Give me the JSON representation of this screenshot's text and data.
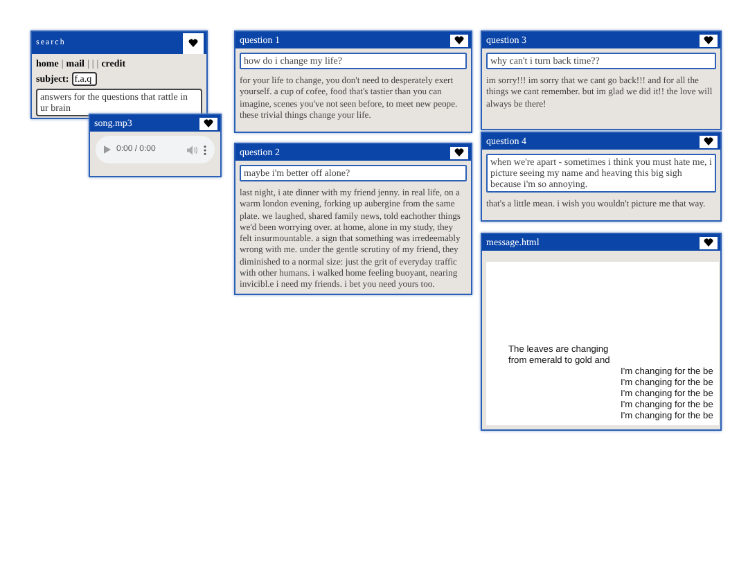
{
  "windows": [
    {
      "kind": "search",
      "title": "search",
      "nav": [
        {
          "kind": "link",
          "text": "home"
        },
        {
          "kind": "sep",
          "text": "|"
        },
        {
          "kind": "link",
          "text": "mail"
        },
        {
          "kind": "sep",
          "text": "|"
        },
        {
          "kind": "sep",
          "text": "|"
        },
        {
          "kind": "sep",
          "text": "|"
        },
        {
          "kind": "link",
          "text": "credit"
        }
      ],
      "subject_label": "subject:",
      "subject_value": "f.a.q",
      "description": "answers for the questions that rattle in ur brain"
    },
    {
      "kind": "audio",
      "title": "song.mp3",
      "time": "0:00 / 0:00"
    },
    {
      "kind": "question",
      "title": "question 1",
      "question": "how do i change my life?",
      "answer": "for your life to change, you don't need to desperately exert yourself. a cup of cofee, food that's tastier than you can imagine, scenes you've not seen before, to meet new peope. these trivial things change your life."
    },
    {
      "kind": "question",
      "title": "question 2",
      "question": "maybe i'm better off alone?",
      "answer": "last night, i ate dinner with my friend jenny. in real life, on a warm london evening, forking up aubergine from the same plate. we laughed, shared family news, told eachother things we'd been worrying over. at home, alone in my study, they felt insurmountable. a sign that something was irredeemably wrong with me. under the gentle scrutiny of my friend, they diminished to a normal size: just the grit of everyday traffic with other humans. i walked home feeling buoyant, nearing invicibl.e i need my friends. i bet you need yours too."
    },
    {
      "kind": "question",
      "title": "question 3",
      "question": "why can't i turn back time??",
      "answer": "im sorry!!! im sorry that we cant go back!!! and for all the things we cant remember. but im glad we did it!! the love will always be there!"
    },
    {
      "kind": "question",
      "title": "question 4",
      "question": "when we're apart - sometimes i think you must hate me, i picture seeing my name and heaving this big sigh because i'm so annoying.",
      "answer": "that's a little mean. i wish you wouldn't picture me that way."
    },
    {
      "kind": "message",
      "title": "message.html",
      "lines": [
        "The leaves are changing",
        "from emerald to gold and",
        "I'm changing for the be",
        "I'm changing for the be",
        "I'm changing for the be",
        "I'm changing for the be",
        "I'm changing for the be"
      ]
    }
  ]
}
